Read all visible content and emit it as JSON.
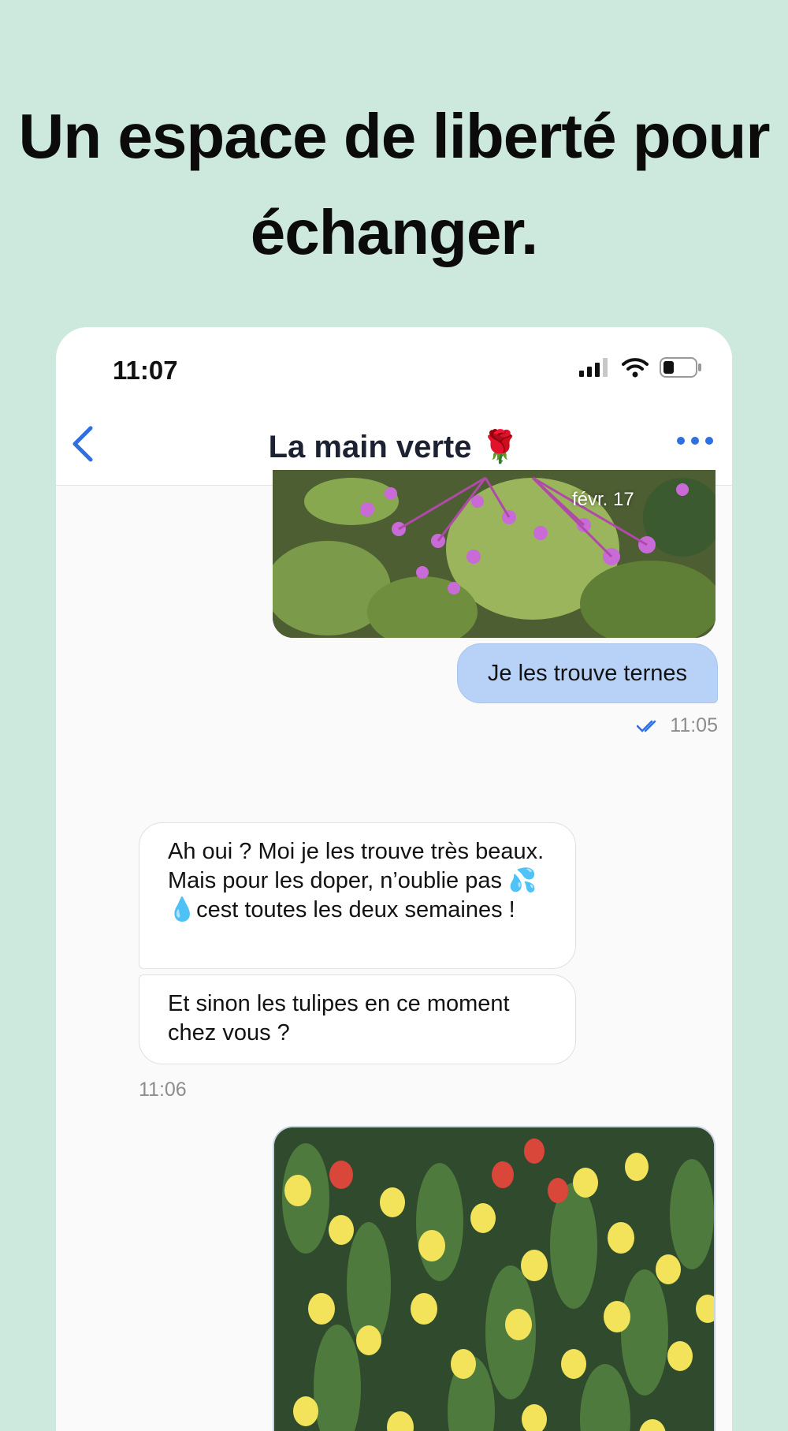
{
  "headline": {
    "line1": "Un espace de liberté pour",
    "line2": "échanger."
  },
  "status_bar": {
    "time": "11:07",
    "icons": [
      "signal-icon",
      "wifi-icon",
      "battery-icon"
    ]
  },
  "nav": {
    "back_icon": "chevron-left-icon",
    "title": "La main verte 🌹",
    "more_icon": "ellipsis-icon"
  },
  "messages": {
    "photo1_date": "févr. 17",
    "outgoing_text": "Je les trouve ternes",
    "outgoing_time": "11:05",
    "incoming": [
      "Ah oui ? Moi je les trouve très beaux. Mais pour les doper, n’oublie pas 💦💧cest toutes les deux semaines !",
      "Et sinon les tulipes en ce moment chez vous ?"
    ],
    "incoming_time": "11:06"
  },
  "colors": {
    "background": "#cde8dd",
    "accent": "#2f6fe0",
    "outgoing_bubble": "#b7d2f6"
  }
}
